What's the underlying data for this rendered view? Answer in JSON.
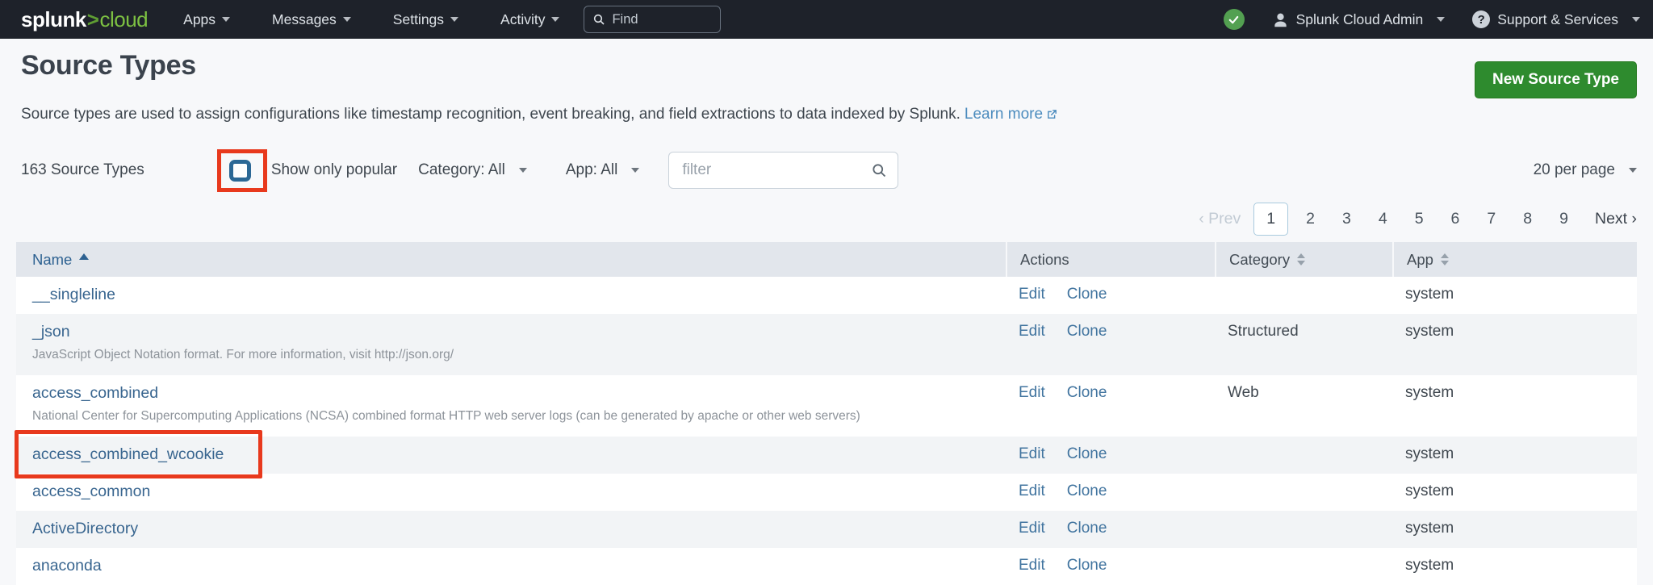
{
  "nav": {
    "logo": {
      "splunk": "splunk",
      "gt": ">",
      "cloud": "cloud"
    },
    "items": [
      {
        "label": "Apps"
      },
      {
        "label": "Messages"
      },
      {
        "label": "Settings"
      },
      {
        "label": "Activity"
      }
    ],
    "find_placeholder": "Find",
    "user_label": "Splunk Cloud Admin",
    "support_label": "Support & Services",
    "status_check": "✓",
    "question_glyph": "?"
  },
  "header": {
    "title": "Source Types",
    "description": "Source types are used to assign configurations like timestamp recognition, event breaking, and field extractions to data indexed by Splunk.",
    "learn_more_label": "Learn more",
    "new_button_label": "New Source Type"
  },
  "filterbar": {
    "count_label": "163 Source Types",
    "popular_label": "Show only popular",
    "category_label": "Category: All",
    "app_label": "App: All",
    "filter_placeholder": "filter",
    "per_page_label": "20 per page"
  },
  "pagination": {
    "prev_label": "‹ Prev",
    "next_label": "Next ›",
    "pages": [
      "1",
      "2",
      "3",
      "4",
      "5",
      "6",
      "7",
      "8",
      "9"
    ],
    "current": "1"
  },
  "table": {
    "headers": {
      "name": "Name",
      "actions": "Actions",
      "category": "Category",
      "app": "App"
    },
    "action_edit": "Edit",
    "action_clone": "Clone",
    "rows": [
      {
        "name": "__singleline",
        "description": "",
        "category": "",
        "app": "system"
      },
      {
        "name": "_json",
        "description": "JavaScript Object Notation format. For more information, visit http://json.org/",
        "category": "Structured",
        "app": "system"
      },
      {
        "name": "access_combined",
        "description": "National Center for Supercomputing Applications (NCSA) combined format HTTP web server logs (can be generated by apache or other web servers)",
        "category": "Web",
        "app": "system"
      },
      {
        "name": "access_combined_wcookie",
        "description": "",
        "category": "",
        "app": "system",
        "annotated": true
      },
      {
        "name": "access_common",
        "description": "",
        "category": "",
        "app": "system"
      },
      {
        "name": "ActiveDirectory",
        "description": "",
        "category": "",
        "app": "system"
      },
      {
        "name": "anaconda",
        "description": "",
        "category": "",
        "app": "system"
      }
    ]
  },
  "colors": {
    "nav-bg": "#1e222a",
    "brand-green": "#7dc142",
    "brand-green-dark": "#5f9e33",
    "status-green": "#53a051",
    "button-green": "#2e8b2e",
    "link-blue": "#38658f",
    "learn-blue": "#4c8cbe",
    "annotation-red": "#e8391d",
    "checkbox-blue": "#2b6795"
  }
}
